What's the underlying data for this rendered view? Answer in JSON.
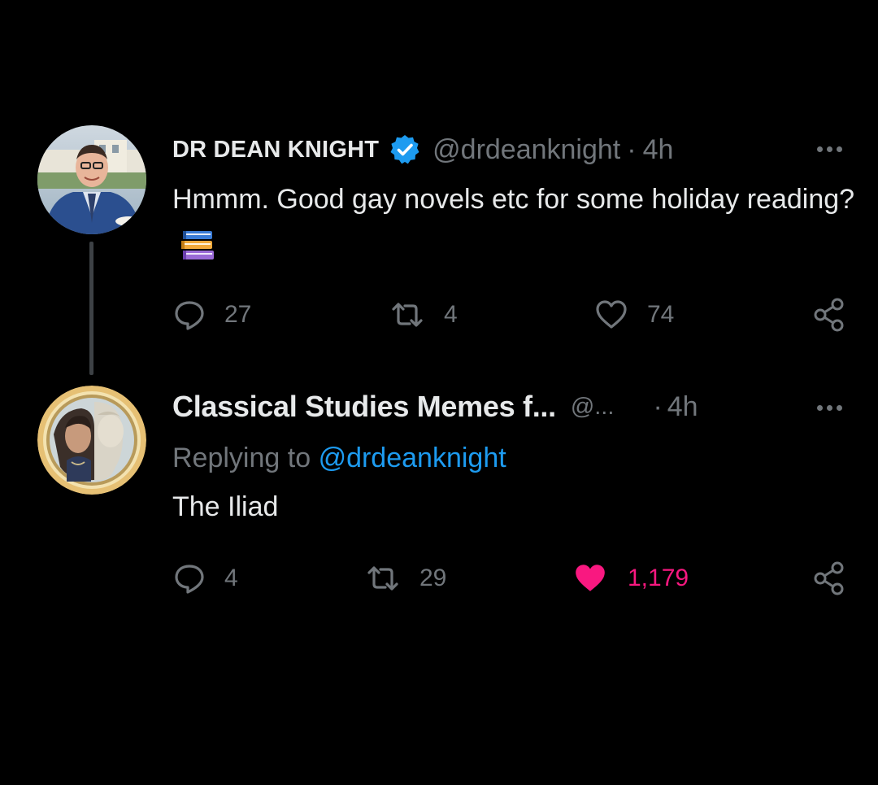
{
  "tweets": [
    {
      "display_name": "DR DEAN KNIGHT",
      "verified": true,
      "handle": "@drdeanknight",
      "separator": "·",
      "time": "4h",
      "text": "Hmmm. Good gay novels etc for some holiday reading?",
      "emoji": "books-icon",
      "counts": {
        "replies": "27",
        "retweets": "4",
        "likes": "74"
      },
      "liked": false
    },
    {
      "display_name": "Classical Studies Memes f...",
      "verified": false,
      "handle": "@...",
      "separator": "·",
      "time": "4h",
      "replying_prefix": "Replying to",
      "replying_to": "@drdeanknight",
      "text": "The Iliad",
      "counts": {
        "replies": "4",
        "retweets": "29",
        "likes": "1,179"
      },
      "liked": true
    }
  ],
  "colors": {
    "background": "#000000",
    "text": "#e7e9ea",
    "muted": "#71767b",
    "mention": "#1d9bf0",
    "like_active": "#f91880",
    "verified_badge": "#1d9bf0"
  }
}
